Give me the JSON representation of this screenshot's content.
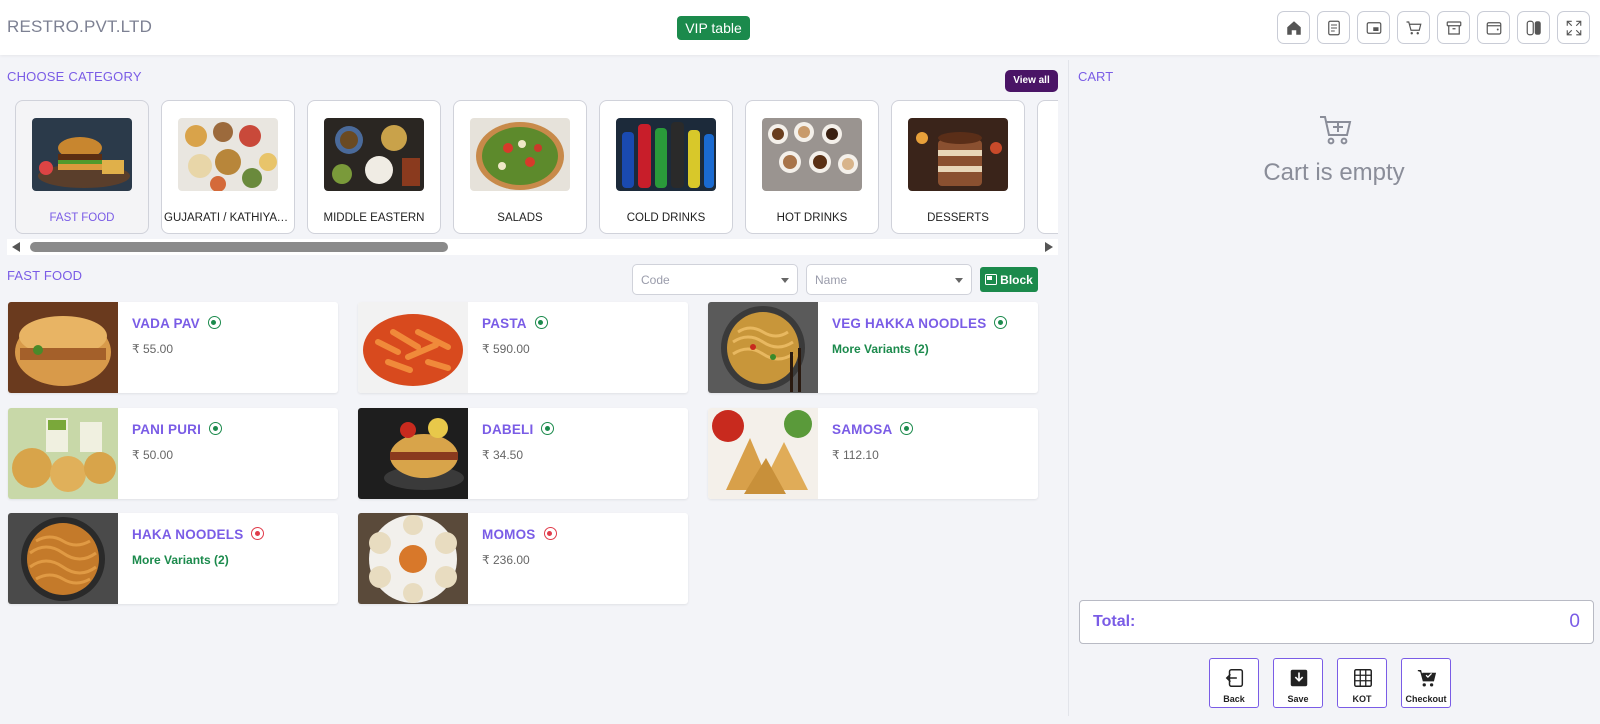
{
  "header": {
    "brand": "RESTRO.PVT.LTD",
    "table_badge": "VIP table",
    "icons": [
      "home-icon",
      "receipt-icon",
      "picture-in-picture-icon",
      "cart-icon",
      "archive-icon",
      "wallet-icon",
      "switch-icon",
      "fullscreen-icon"
    ]
  },
  "category_section": {
    "title": "CHOOSE CATEGORY",
    "view_all": "View all",
    "categories": [
      {
        "label": "FAST FOOD",
        "active": true
      },
      {
        "label": "GUJARATI / KATHIYAWADI",
        "active": false
      },
      {
        "label": "MIDDLE EASTERN",
        "active": false
      },
      {
        "label": "SALADS",
        "active": false
      },
      {
        "label": "COLD DRINKS",
        "active": false
      },
      {
        "label": "HOT DRINKS",
        "active": false
      },
      {
        "label": "DESSERTS",
        "active": false
      }
    ]
  },
  "items_section": {
    "title": "FAST FOOD",
    "code_placeholder": "Code",
    "name_placeholder": "Name",
    "block_label": "Block",
    "items": [
      {
        "name": "VADA PAV",
        "price": "₹ 55.00",
        "type": "veg"
      },
      {
        "name": "PASTA",
        "price": "₹ 590.00",
        "type": "veg"
      },
      {
        "name": "VEG HAKKA NOODLES",
        "variants": "More Variants (2)",
        "type": "veg"
      },
      {
        "name": "PANI PURI",
        "price": "₹ 50.00",
        "type": "veg"
      },
      {
        "name": "DABELI",
        "price": "₹ 34.50",
        "type": "veg"
      },
      {
        "name": "SAMOSA",
        "price": "₹ 112.10",
        "type": "veg"
      },
      {
        "name": "HAKA NOODELS",
        "variants": "More Variants (2)",
        "type": "nonveg"
      },
      {
        "name": "MOMOS",
        "price": "₹ 236.00",
        "type": "nonveg"
      }
    ]
  },
  "cart": {
    "title": "CART",
    "empty_text": "Cart is empty",
    "total_label": "Total:",
    "total_value": "0",
    "actions": [
      "Back",
      "Save",
      "KOT",
      "Checkout"
    ]
  },
  "colors": {
    "accent": "#7a5ce6",
    "green": "#1b8a4c",
    "view_all_bg": "#4a1466",
    "nonveg": "#e03b4a"
  }
}
